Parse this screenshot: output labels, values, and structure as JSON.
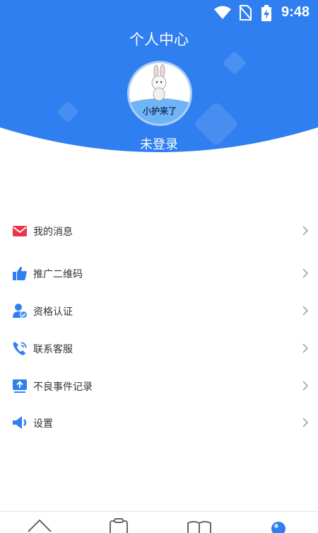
{
  "colors": {
    "primary": "#2f7ff0",
    "text": "#333333",
    "chevron": "#999999"
  },
  "status_bar": {
    "time": "9:48",
    "icons": [
      "wifi-icon",
      "no-sim-icon",
      "battery-charging-icon"
    ]
  },
  "header": {
    "title": "个人中心",
    "login_text": "未登录"
  },
  "avatar": {
    "logo_text": "小护来了"
  },
  "menu": {
    "items": [
      {
        "label": "我的消息",
        "icon": "mail-icon"
      },
      {
        "label": "推广二维码",
        "icon": "thumbs-up-icon"
      },
      {
        "label": "资格认证",
        "icon": "user-verified-icon"
      },
      {
        "label": "联系客服",
        "icon": "phone-icon"
      },
      {
        "label": "不良事件记录",
        "icon": "upload-record-icon"
      },
      {
        "label": "设置",
        "icon": "speaker-icon"
      }
    ]
  },
  "tab_bar": {
    "tabs": [
      "home-icon",
      "clipboard-icon",
      "book-icon",
      "profile-icon"
    ]
  }
}
